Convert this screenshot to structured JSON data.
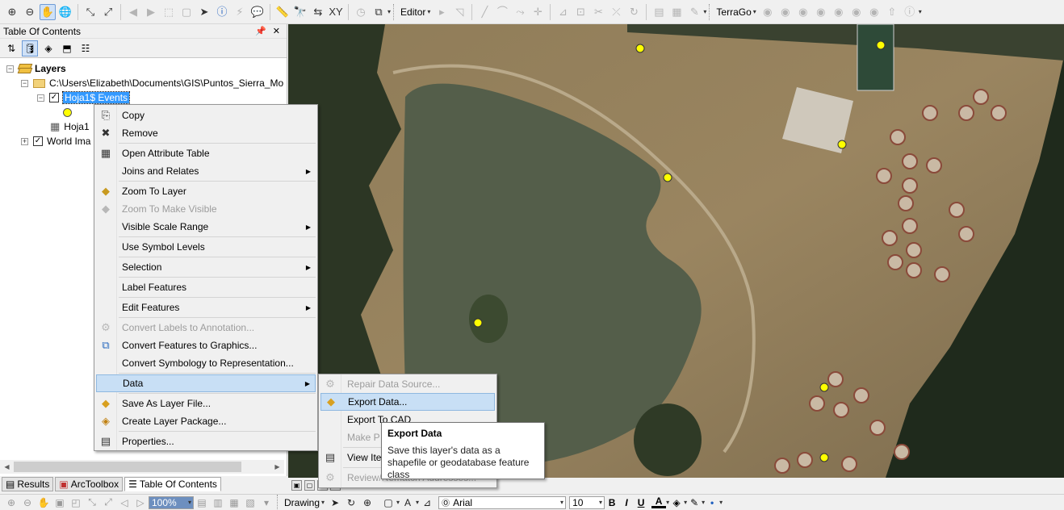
{
  "toolbar": {
    "editor_label": "Editor",
    "terrago_label": "TerraGo"
  },
  "toc": {
    "title": "Table Of Contents",
    "tree": {
      "root_label": "Layers",
      "path_label": "C:\\Users\\Elizabeth\\Documents\\GIS\\Puntos_Sierra_Mo",
      "events_label": "Hoja1$ Events",
      "table_label": "Hoja1",
      "world_label": "World Ima"
    }
  },
  "tabs": {
    "results": "Results",
    "arctoolbox": "ArcToolbox",
    "toc": "Table Of Contents"
  },
  "context_menu": {
    "copy": "Copy",
    "remove": "Remove",
    "open_attr": "Open Attribute Table",
    "joins": "Joins and Relates",
    "zoom_layer": "Zoom To Layer",
    "zoom_visible": "Zoom To Make Visible",
    "scale_range": "Visible Scale Range",
    "symbol_levels": "Use Symbol Levels",
    "selection": "Selection",
    "label_features": "Label Features",
    "edit_features": "Edit Features",
    "convert_labels": "Convert Labels to Annotation...",
    "convert_graphics": "Convert Features to Graphics...",
    "convert_symbology": "Convert Symbology to Representation...",
    "data": "Data",
    "save_layer": "Save As Layer File...",
    "create_package": "Create Layer Package...",
    "properties": "Properties..."
  },
  "submenu": {
    "repair": "Repair Data Source...",
    "export_data": "Export Data...",
    "export_cad": "Export To CAD",
    "make_p": "Make P",
    "view_item": "View Ite",
    "review": "Review/Rematch Addresses..."
  },
  "tooltip": {
    "title": "Export Data",
    "body": "Save this layer's data as a shapefile or geodatabase feature class"
  },
  "bottom": {
    "zoom_value": "100%",
    "drawing_label": "Drawing",
    "font_name": "Arial",
    "font_size": "10",
    "bold": "B",
    "italic": "I",
    "underline": "U",
    "font_color": "A"
  }
}
